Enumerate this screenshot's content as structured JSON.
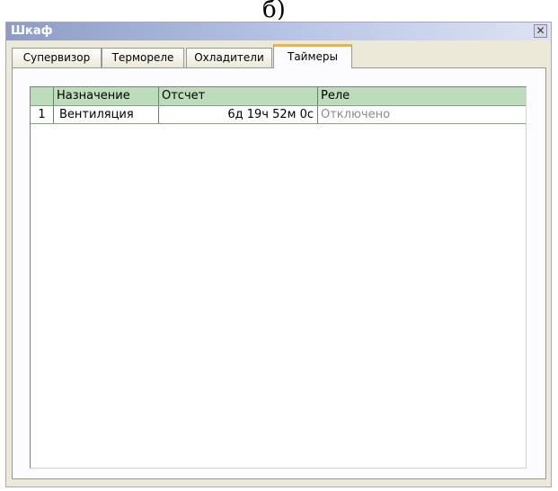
{
  "caption_fragment": "б)",
  "window": {
    "title": "Шкаф",
    "close_glyph": "✕"
  },
  "tabs": [
    {
      "label": "Супервизор",
      "active": false
    },
    {
      "label": "Термореле",
      "active": false
    },
    {
      "label": "Охладители",
      "active": false
    },
    {
      "label": "Таймеры",
      "active": true
    }
  ],
  "table": {
    "columns": [
      "",
      "Назначение",
      "Отсчет",
      "Реле"
    ],
    "rows": [
      {
        "index": "1",
        "name": "Вентиляция",
        "countdown": "6д 19ч 52м 0с",
        "relay": "Отключено"
      }
    ]
  },
  "colors": {
    "header_bg": "#bcdcbc",
    "active_tab_accent": "#f4b045",
    "disabled_text": "#8c8c8c"
  }
}
